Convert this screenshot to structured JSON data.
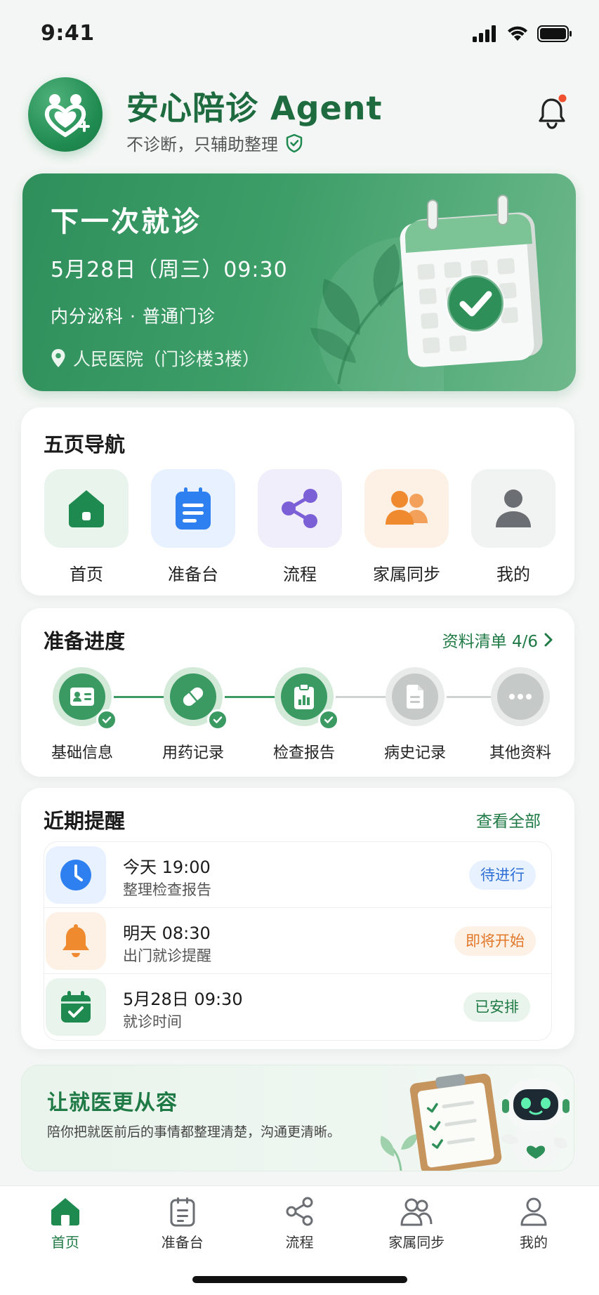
{
  "status_bar": {
    "time": "9:41"
  },
  "header": {
    "title": "安心陪诊 Agent",
    "subtitle": "不诊断，只辅助整理"
  },
  "next_visit": {
    "title": "下一次就诊",
    "datetime": "5月28日（周三）09:30",
    "department": "内分泌科 · 普通门诊",
    "location": "人民医院（门诊楼3楼）"
  },
  "navigation": {
    "title": "五页导航",
    "items": [
      {
        "label": "首页",
        "icon": "home-icon",
        "color": "#1f8a4f"
      },
      {
        "label": "准备台",
        "icon": "clipboard-icon",
        "color": "#2e7ff0"
      },
      {
        "label": "流程",
        "icon": "share-flow-icon",
        "color": "#7b5fd6"
      },
      {
        "label": "家属同步",
        "icon": "family-icon",
        "color": "#f08a2e"
      },
      {
        "label": "我的",
        "icon": "user-icon",
        "color": "#6b6f73"
      }
    ]
  },
  "progress": {
    "title": "准备进度",
    "checklist_link": "资料清单 4/6",
    "steps": [
      {
        "label": "基础信息",
        "done": true,
        "icon": "id-card-icon"
      },
      {
        "label": "用药记录",
        "done": true,
        "icon": "pill-icon"
      },
      {
        "label": "检查报告",
        "done": true,
        "icon": "report-icon"
      },
      {
        "label": "病史记录",
        "done": false,
        "icon": "document-icon"
      },
      {
        "label": "其他资料",
        "done": false,
        "icon": "more-icon"
      }
    ]
  },
  "reminders": {
    "title": "近期提醒",
    "view_all": "查看全部",
    "items": [
      {
        "time": "今天 19:00",
        "desc": "整理检查报告",
        "status": "待进行",
        "icon": "clock-icon",
        "accent": "#2e7ff0"
      },
      {
        "time": "明天 08:30",
        "desc": "出门就诊提醒",
        "status": "即将开始",
        "icon": "bell-icon",
        "accent": "#f08a2e"
      },
      {
        "time": "5月28日 09:30",
        "desc": "就诊时间",
        "status": "已安排",
        "icon": "calendar-check-icon",
        "accent": "#1f8a4f"
      }
    ]
  },
  "promo": {
    "title": "让就医更从容",
    "text": "陪你把就医前后的事情都整理清楚，沟通更清晰。"
  },
  "tabbar": {
    "items": [
      {
        "label": "首页",
        "icon": "home-icon",
        "active": true
      },
      {
        "label": "准备台",
        "icon": "clipboard-icon",
        "active": false
      },
      {
        "label": "流程",
        "icon": "share-flow-icon",
        "active": false
      },
      {
        "label": "家属同步",
        "icon": "family-icon",
        "active": false
      },
      {
        "label": "我的",
        "icon": "user-icon",
        "active": false
      }
    ]
  }
}
